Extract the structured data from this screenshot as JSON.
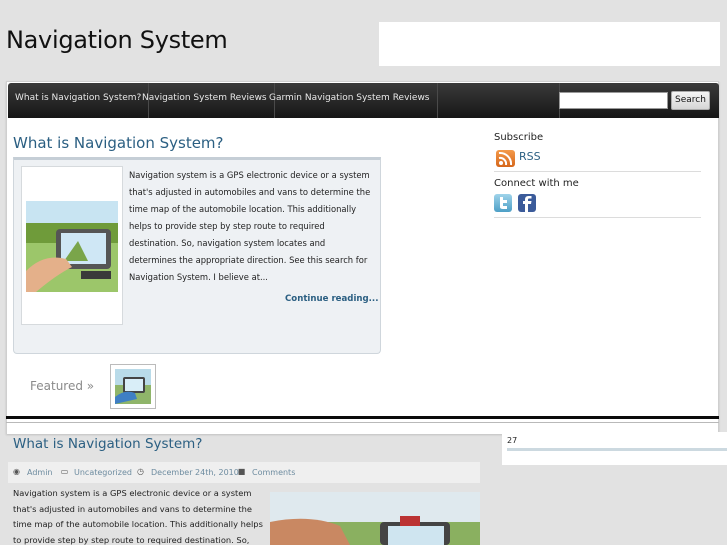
{
  "site": {
    "title": "Navigation System"
  },
  "nav": {
    "items": [
      {
        "label": "What is Navigation System?"
      },
      {
        "label": "Navigation System Reviews"
      },
      {
        "label": "Garmin Navigation System Reviews"
      }
    ],
    "search": {
      "value": "",
      "button_label": "Search"
    }
  },
  "post": {
    "title": "What is Navigation System?",
    "excerpt": "Navigation system is a GPS electronic device or a system that's adjusted in automobiles and vans to determine the time map of the automobile location. This additionally helps to provide step by step route to required destination. So, navigation system locates and determines the appropriate direction. See this search for Navigation System. I believe at...",
    "continue_label": "Continue reading..."
  },
  "featured": {
    "label": "Featured »"
  },
  "sidebar": {
    "subscribe_heading": "Subscribe",
    "rss_label": "RSS",
    "connect_heading": "Connect with me"
  },
  "post2": {
    "title": "What is Navigation System?",
    "meta": {
      "author": "Admin",
      "category": "Uncategorized",
      "date": "December 24th, 2010",
      "comments": "Comments"
    },
    "text": "Navigation system is a GPS electronic device or a system that's adjusted in automobiles and vans to determine the time map of the automobile location. This additionally helps to provide step by step route to required destination. So, navigation system"
  },
  "side2": {
    "number": "27"
  },
  "colors": {
    "link": "#2b5f82",
    "nav_bg": "#1f1f1f",
    "rss": "#e87b2c",
    "facebook": "#3b5b9a",
    "twitter": "#6db6d9"
  },
  "icons": [
    "rss-icon",
    "twitter-icon",
    "facebook-icon",
    "user-icon",
    "folder-icon",
    "clock-icon",
    "comment-icon"
  ]
}
